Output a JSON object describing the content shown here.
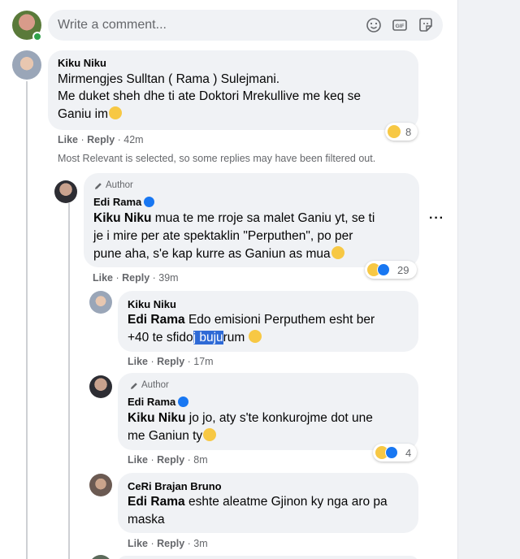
{
  "composer": {
    "placeholder": "Write a comment..."
  },
  "comments": [
    {
      "author": "Kiku Niku",
      "line1": "Mirmengjes Sulltan ( Rama ) Sulejmani.",
      "line2": "Me duket sheh dhe ti ate Doktori Mrekullive me keq se",
      "line3": "Ganiu im",
      "like": "Like",
      "reply": "Reply",
      "time": "42m",
      "reaction_count": "8"
    }
  ],
  "filter_note": "Most Relevant is selected, so some replies may have been filtered out.",
  "replies": [
    {
      "badge": "Author",
      "author": "Edi Rama",
      "mention": "Kiku Niku",
      "line1": " mua te me rroje sa malet Ganiu yt, se ti",
      "line2": "je i mire per ate spektaklin \"Perputhen\", po per",
      "line3": "pune aha, s'e kap kurre as Ganiun as mua",
      "like": "Like",
      "reply": "Reply",
      "time": "39m",
      "reaction_count": "29"
    },
    {
      "author": "Kiku Niku",
      "mention": "Edi Rama",
      "line1": " Edo emisioni Perputhem esht ber",
      "line2a": "+40 te sfido",
      "line2sel": "j buju",
      "line2b": "rum",
      "like": "Like",
      "reply": "Reply",
      "time": "17m"
    },
    {
      "badge": "Author",
      "author": "Edi Rama",
      "mention": "Kiku Niku",
      "line1": " jo jo, aty s'te konkurojme dot une",
      "line2": "me Ganiun ty",
      "like": "Like",
      "reply": "Reply",
      "time": "8m",
      "reaction_count": "4"
    },
    {
      "author": "CeRi Brajan Bruno",
      "mention": "Edi Rama",
      "line1": " eshte aleatme Gjinon ky nga aro pa",
      "line2": "maska",
      "like": "Like",
      "reply": "Reply",
      "time": "3m"
    }
  ],
  "icons": {
    "composer": [
      "smiley-icon",
      "gif-icon",
      "sticker-icon"
    ],
    "reactions": [
      "haha-emoji-icon",
      "like-reaction-icon"
    ],
    "more": "more-options-icon"
  },
  "colors": {
    "accent": "#1877f2",
    "bubble": "#f0f2f5",
    "muted": "#65676b",
    "selection": "#2e6ad6"
  }
}
